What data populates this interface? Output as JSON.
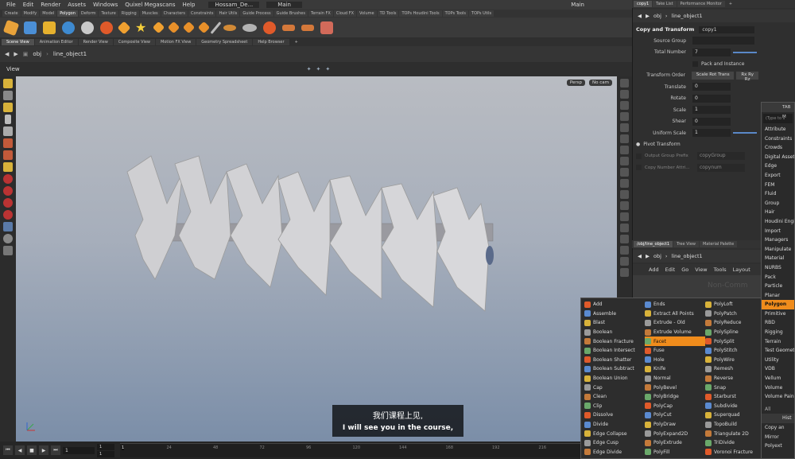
{
  "menubar": {
    "items": [
      "File",
      "Edit",
      "Render",
      "Assets",
      "Windows",
      "Quixel Megascans",
      "Help"
    ],
    "desktop": "Hossam_De...",
    "network_main": "Main",
    "window_main": "Main"
  },
  "shelf_tabs": [
    "Create",
    "Modify",
    "Model",
    "Polygon",
    "Deform",
    "Texture",
    "Rigging",
    "Muscles",
    "Characters",
    "Constraints",
    "Hair Utils",
    "Guide Process",
    "Guide Brushes",
    "Terrain FX",
    "Cloud FX",
    "Volume",
    "TD Tools",
    "TOPs Houdini Tools",
    "TOPs Tools",
    "TOPs Utils"
  ],
  "shelf_active": "Polygon",
  "pane_tabs": [
    "Scene View",
    "Animation Editor",
    "Render View",
    "Composite View",
    "Motion FX View",
    "Geometry Spreadsheet",
    "Help Browser"
  ],
  "pane_active": "Scene View",
  "path": {
    "root": "obj",
    "node": "line_object1"
  },
  "view": {
    "title": "View",
    "persp": "Persp",
    "cam": "No cam"
  },
  "timeline": {
    "current": "1",
    "start": "1",
    "start2": "1",
    "end": "240",
    "end2": "240",
    "ticks": [
      "1",
      "24",
      "48",
      "72",
      "96",
      "120",
      "144",
      "168",
      "192",
      "216",
      "240"
    ]
  },
  "right_tabs": [
    "copy1",
    "Take List",
    "Performance Monitor"
  ],
  "right_active": "copy1",
  "params": {
    "node_type": "Copy and Transform",
    "node_name": "copy1",
    "rows": [
      {
        "label": "Source Group",
        "value": ""
      },
      {
        "label": "Total Number",
        "value": "7"
      },
      {
        "label": "",
        "value": "Pack and Instance"
      },
      {
        "label": "Transform Order",
        "value": "Scale Rot Trans",
        "value2": "Rx Ry Rz"
      },
      {
        "label": "Translate",
        "value": "0"
      },
      {
        "label": "Rotate",
        "value": "0"
      },
      {
        "label": "Scale",
        "value": "1"
      },
      {
        "label": "Shear",
        "value": "0"
      },
      {
        "label": "Uniform Scale",
        "value": "1"
      },
      {
        "label": "Pivot Transform",
        "value": ""
      },
      {
        "label": "Output Group Prefix",
        "value": "copyGroup"
      },
      {
        "label": "Copy Number Attri...",
        "value": "copynum"
      }
    ]
  },
  "net_tabs": [
    "/obj/line_object1",
    "Tree View",
    "Material Palette"
  ],
  "net_path": {
    "root": "obj",
    "node": "line_object1"
  },
  "net_menu": [
    "Add",
    "Edit",
    "Go",
    "View",
    "Tools",
    "Layout"
  ],
  "net_watermark": "Non-Comm",
  "tab_menu": {
    "header": "TAB M",
    "search": "(Type to s",
    "items": [
      "Attribute",
      "Constraints",
      "Crowds",
      "Digital Asset",
      "Edge",
      "Export",
      "FEM",
      "Fluid",
      "Group",
      "Hair",
      "Houdini Engi",
      "Import",
      "Managers",
      "Manipulate",
      "Material",
      "NURBS",
      "Pack",
      "Particle",
      "Planar",
      "Polygon",
      "Primitive",
      "RBD",
      "Rigging",
      "Terrain",
      "Test Geometry",
      "Utility",
      "VDB",
      "Vellum",
      "Volume",
      "Volume Paint"
    ],
    "selected": "Polygon",
    "all": "All",
    "history": "Hist",
    "recent": [
      "Copy an",
      "Mirror",
      "Polyext"
    ]
  },
  "poly_menu": {
    "col1": [
      "Add",
      "Assemble",
      "Blast",
      "Boolean",
      "Boolean Fracture",
      "Boolean Intersect",
      "Boolean Shatter",
      "Boolean Subtract",
      "Boolean Union",
      "Cap",
      "Clean",
      "Clip",
      "Dissolve",
      "Divide",
      "Edge Collapse",
      "Edge Cusp",
      "Edge Divide"
    ],
    "col2": [
      "Ends",
      "Extract All Points",
      "Extrude - Old",
      "Extrude Volume",
      "Facet",
      "Fuse",
      "Hole",
      "Knife",
      "Normal",
      "PolyBevel",
      "PolyBridge",
      "PolyCap",
      "PolyCut",
      "PolyDraw",
      "PolyExpand2D",
      "PolyExtrude",
      "PolyFill"
    ],
    "col3": [
      "PolyLoft",
      "PolyPatch",
      "PolyReduce",
      "PolySpline",
      "PolySplit",
      "PolyStitch",
      "PolyWire",
      "Remesh",
      "Reverse",
      "Snap",
      "Starburst",
      "Subdivide",
      "Superquad",
      "TopoBuild",
      "Triangulate 2D",
      "TriDivide",
      "Voronoi Fracture"
    ],
    "selected": "Facet"
  },
  "subtitle": {
    "zh": "我们课程上见,",
    "en": "I will see you in the course,"
  },
  "colors": {
    "accent": "#f08c1c"
  }
}
